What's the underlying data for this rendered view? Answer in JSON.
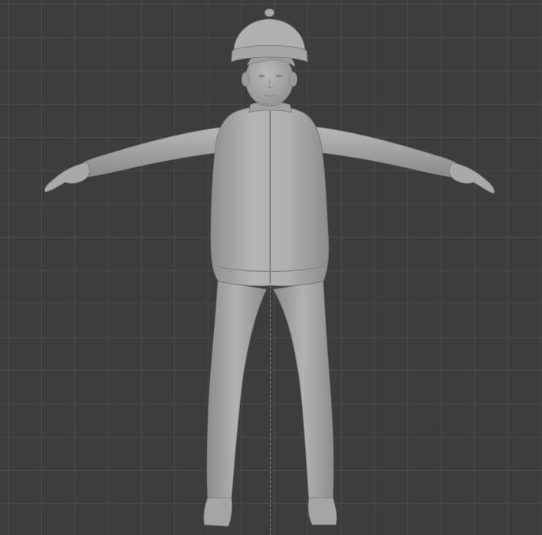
{
  "viewport": {
    "background_color": "#3d3d3d",
    "grid_color": "#4a4a4a",
    "z_axis_color": "#5a7fbf"
  },
  "model": {
    "material_color": "#a8a8a8",
    "shadow_color": "#8a8a8a",
    "highlight_color": "#bdbdbd"
  }
}
